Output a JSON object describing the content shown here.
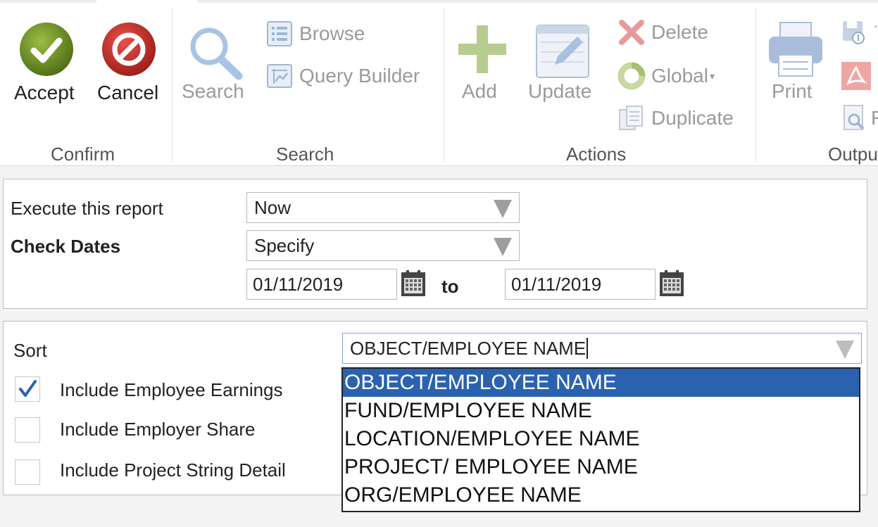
{
  "ribbon": {
    "confirm": {
      "group_label": "Confirm",
      "accept_label": "Accept",
      "cancel_label": "Cancel"
    },
    "search": {
      "group_label": "Search",
      "search_label": "Search",
      "browse_label": "Browse",
      "query_builder_label": "Query Builder"
    },
    "actions": {
      "group_label": "Actions",
      "add_label": "Add",
      "update_label": "Update",
      "delete_label": "Delete",
      "global_label": "Global",
      "duplicate_label": "Duplicate"
    },
    "output": {
      "group_label": "Outpu",
      "print_label": "Print",
      "partial_label": "F"
    }
  },
  "report": {
    "execute_label": "Execute this report",
    "execute_value": "Now",
    "check_dates_label": "Check Dates",
    "check_dates_value": "Specify",
    "date_from": "01/11/2019",
    "to_label": "to",
    "date_to": "01/11/2019"
  },
  "sort": {
    "label": "Sort",
    "value": "OBJECT/EMPLOYEE NAME",
    "options": [
      "OBJECT/EMPLOYEE NAME",
      "FUND/EMPLOYEE NAME",
      "LOCATION/EMPLOYEE NAME",
      "PROJECT/ EMPLOYEE NAME",
      "ORG/EMPLOYEE NAME"
    ],
    "selected_index": 0
  },
  "options": [
    {
      "label": "Include Employee Earnings",
      "checked": true
    },
    {
      "label": "Include Employer Share",
      "checked": false
    },
    {
      "label": "Include Project String Detail",
      "checked": false
    }
  ],
  "colors": {
    "accept": "#6b8e23",
    "cancel": "#c0392b",
    "selection": "#2a62b0",
    "disabled_icon": "#9fb6d6"
  },
  "icons": [
    "checkmark-icon",
    "cancel-icon",
    "search-icon",
    "browse-icon",
    "query-builder-icon",
    "add-icon",
    "update-icon",
    "delete-icon",
    "global-icon",
    "duplicate-icon",
    "print-icon",
    "calendar-icon",
    "dropdown-arrow-icon"
  ]
}
